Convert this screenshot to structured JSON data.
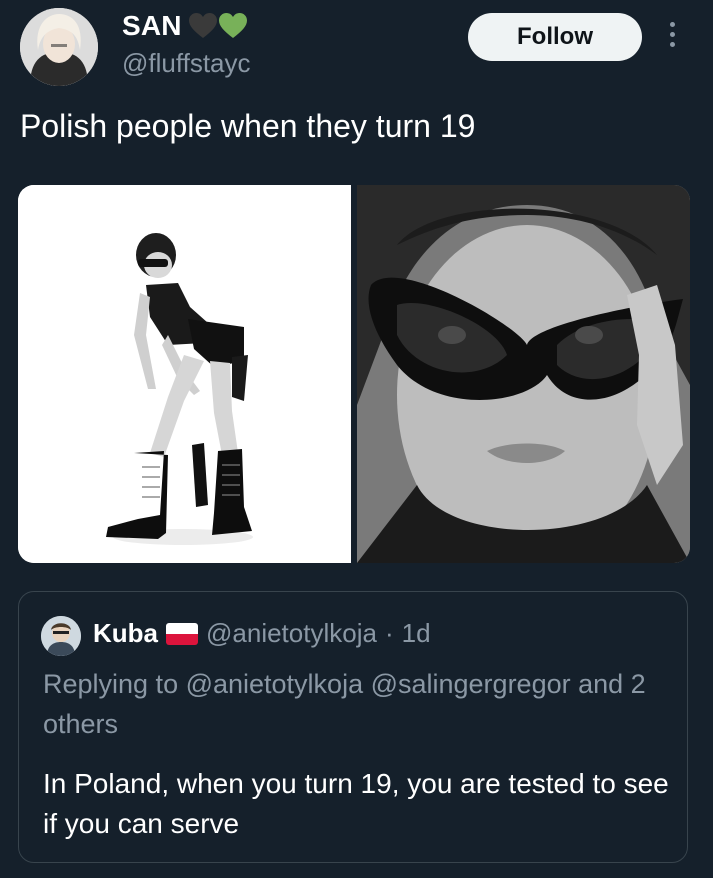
{
  "author": {
    "display_name": "SAN",
    "emoji": [
      "black-heart",
      "green-heart"
    ],
    "handle": "@fluffstayc"
  },
  "follow_label": "Follow",
  "tweet_text": "Polish people when they turn 19",
  "media": {
    "count": 2,
    "style": "black-and-white photos"
  },
  "quoted_tweet": {
    "display_name": "Kuba",
    "flag": "poland-flag",
    "handle": "@anietotylkoja",
    "separator": "·",
    "time": "1d",
    "replying_to": "Replying to @anietotylkoja @salingergregor and 2 others",
    "text": "In Poland, when you turn 19, you are tested to see if you can serve"
  },
  "colors": {
    "background": "#15202b",
    "primary_text": "#ffffff",
    "secondary_text": "#8b98a5",
    "border": "#38444d",
    "follow_bg": "#eff3f4",
    "black_heart": "#3a3a3a",
    "green_heart": "#78b159",
    "flag_red": "#dc143c"
  }
}
